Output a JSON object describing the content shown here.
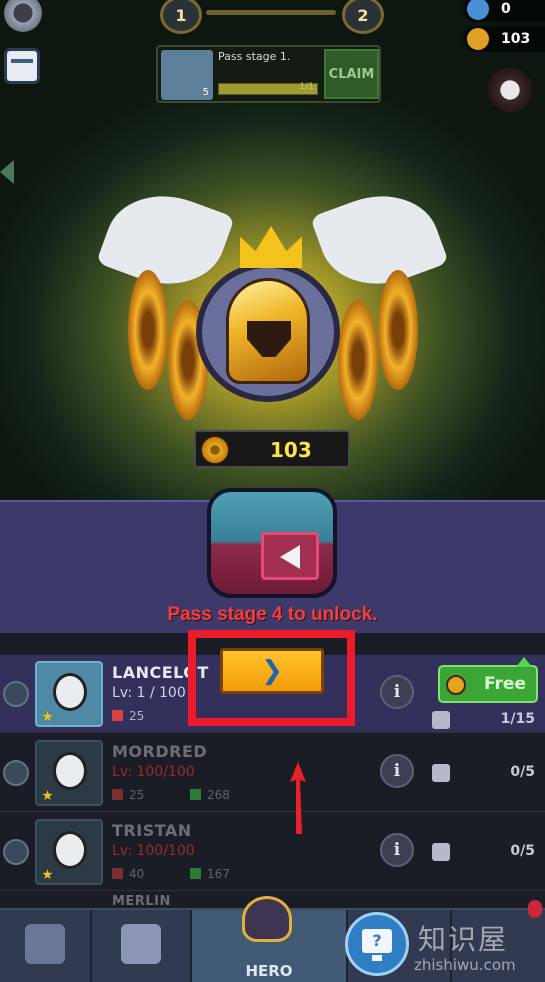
{
  "top": {
    "stage_current": "1",
    "stage_next": "2",
    "gems": "0",
    "coins": "103"
  },
  "quest": {
    "level": "5",
    "title": "Pass stage 1.",
    "progress": "1/1",
    "progress_fraction": 1.0,
    "claim_label": "CLAIM"
  },
  "reward": {
    "coin_amount": "103"
  },
  "chest": {
    "unlock_text": "Pass stage 4 to unlock."
  },
  "heroes": [
    {
      "name": "LANCELOT",
      "lv": "Lv:  1 / 100",
      "attack": "25",
      "health": "",
      "shards": "1/15",
      "free_label": "Free",
      "active": true
    },
    {
      "name": "MORDRED",
      "lv": "Lv: 100/100",
      "attack": "25",
      "health": "268",
      "shards": "0/5",
      "active": false
    },
    {
      "name": "TRISTAN",
      "lv": "Lv: 100/100",
      "attack": "40",
      "health": "167",
      "shards": "0/5",
      "active": false
    },
    {
      "name": "MERLIN",
      "active": false
    }
  ],
  "nav": {
    "hero_label": "HERO",
    "help_glyph": "?"
  },
  "watermark": {
    "chinese": "知识屋",
    "url": "zhishiwu.com"
  },
  "colors": {
    "highlight": "#ed1b2a",
    "unlock_text": "#f23f3f",
    "free_button": "#3ba538",
    "coin_text": "#fbe64a"
  },
  "icons": {
    "settings": "gear-icon",
    "calendar": "calendar-icon",
    "boss": "skull-icon",
    "info": "info-icon",
    "shard": "puzzle-icon",
    "next": "chevron-right-icon",
    "help": "help-monitor-icon"
  }
}
